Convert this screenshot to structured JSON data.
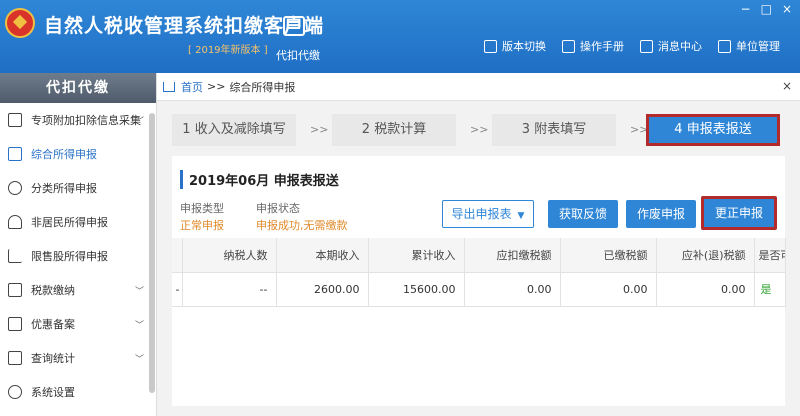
{
  "header": {
    "app_title": "自然人税收管理系统扣缴客户端",
    "version_badge": "2019年新版本",
    "module_label": "代扣代缴",
    "buttons": [
      {
        "label": "版本切换",
        "icon": "swap-icon"
      },
      {
        "label": "操作手册",
        "icon": "manual-icon"
      },
      {
        "label": "消息中心",
        "icon": "mail-icon"
      },
      {
        "label": "单位管理",
        "icon": "building-icon"
      }
    ],
    "window_controls": [
      "−",
      "□",
      "×"
    ]
  },
  "sidebar": {
    "title": "代扣代缴",
    "items": [
      {
        "label": "专项附加扣除信息采集",
        "icon": "list-icon",
        "has_chevron": true,
        "active": false
      },
      {
        "label": "综合所得申报",
        "icon": "layers-icon",
        "has_chevron": false,
        "active": true
      },
      {
        "label": "分类所得申报",
        "icon": "pie-icon",
        "has_chevron": false,
        "active": false
      },
      {
        "label": "非居民所得申报",
        "icon": "person-icon",
        "has_chevron": false,
        "active": false
      },
      {
        "label": "限售股所得申报",
        "icon": "bar-chart-icon",
        "has_chevron": false,
        "active": false
      },
      {
        "label": "税款缴纳",
        "icon": "wallet-icon",
        "has_chevron": true,
        "active": false
      },
      {
        "label": "优惠备案",
        "icon": "document-icon",
        "has_chevron": true,
        "active": false
      },
      {
        "label": "查询统计",
        "icon": "search-list-icon",
        "has_chevron": true,
        "active": false
      },
      {
        "label": "系统设置",
        "icon": "gear-icon",
        "has_chevron": false,
        "active": false
      }
    ]
  },
  "breadcrumb": {
    "home": "首页",
    "separator": ">>",
    "current": "综合所得申报",
    "close": "×"
  },
  "steps": [
    {
      "label": "1 收入及减除填写",
      "active": false
    },
    {
      "label": "2 税款计算",
      "active": false
    },
    {
      "label": "3 附表填写",
      "active": false
    },
    {
      "label": "4 申报表报送",
      "active": true
    }
  ],
  "step_separator": ">>",
  "panel": {
    "title": "2019年06月  申报表报送",
    "declare_type_label": "申报类型",
    "declare_type_value": "正常申报",
    "declare_status_label": "申报状态",
    "declare_status_value": "申报成功,无需缴款",
    "buttons": {
      "export": "导出申报表",
      "feedback": "获取反馈",
      "void": "作废申报",
      "correct": "更正申报"
    },
    "table": {
      "columns": [
        "",
        "纳税人数",
        "本期收入",
        "累计收入",
        "应扣缴税额",
        "已缴税额",
        "应补(退)税额",
        "是否可"
      ],
      "rows": [
        [
          "-",
          "--",
          "2600.00",
          "15600.00",
          "0.00",
          "0.00",
          "0.00",
          "是"
        ]
      ]
    }
  },
  "colors": {
    "primary": "#2f86d6",
    "highlight_border": "#b22a2a",
    "warning_text": "#e08a2a"
  }
}
